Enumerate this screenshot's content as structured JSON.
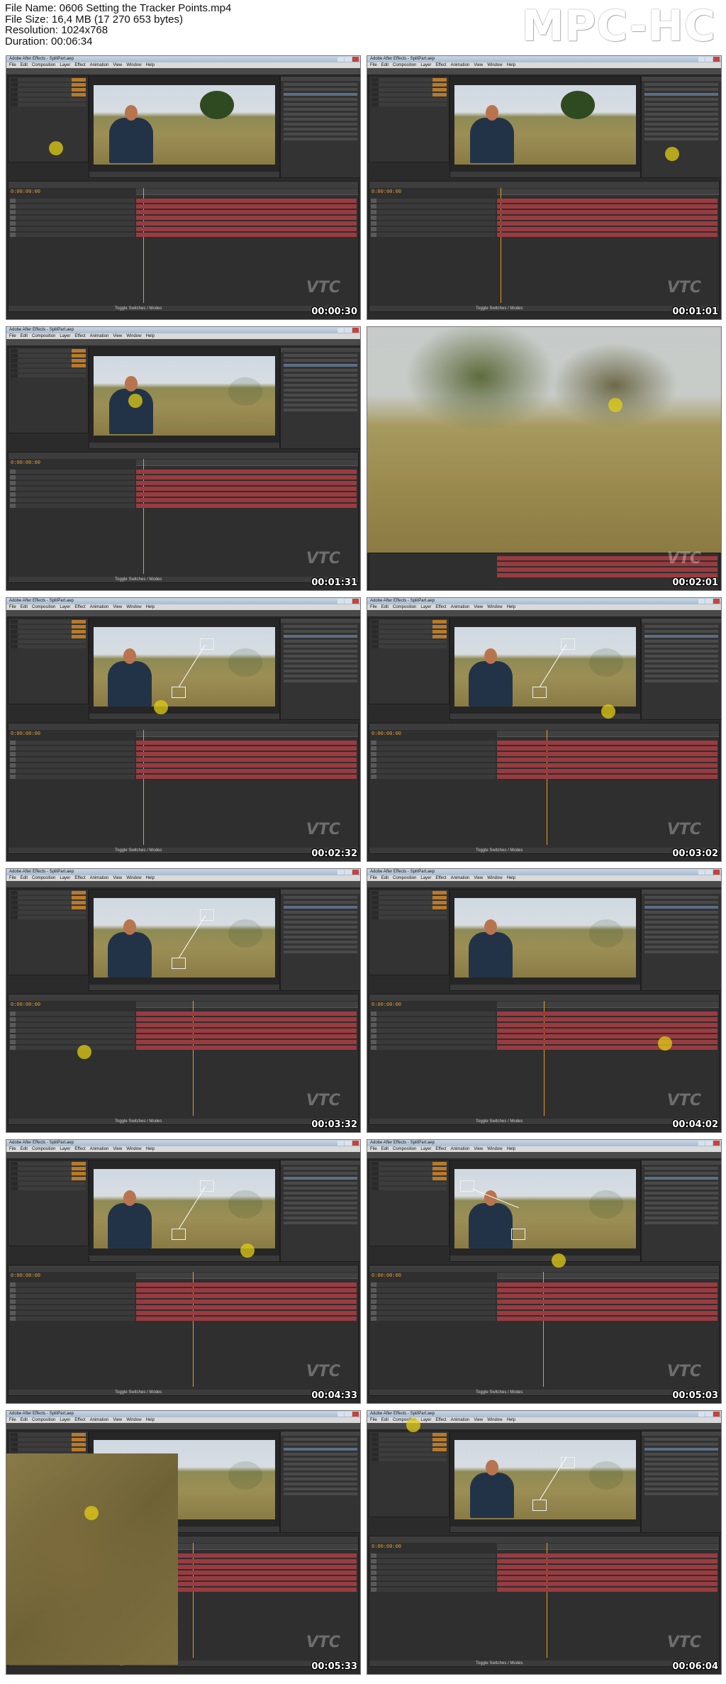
{
  "file_info": {
    "name_line": "File Name: 0606 Setting the Tracker Points.mp4",
    "size_line": "File Size: 16,4 MB (17 270 653 bytes)",
    "resolution_line": "Resolution: 1024x768",
    "duration_line": "Duration: 00:06:34"
  },
  "brand": "MPC-HC",
  "app": {
    "window_title": "Adobe After Effects - SplitPart.aep",
    "menus": [
      "File",
      "Edit",
      "Composition",
      "Layer",
      "Effect",
      "Animation",
      "View",
      "Window",
      "Help"
    ],
    "watermark": "VTC",
    "timeline_footer": "Toggle Switches / Modes",
    "timecode": "0:00:00:00"
  },
  "thumbnails": [
    {
      "timestamp": "00:00:30",
      "kind": "ui"
    },
    {
      "timestamp": "00:01:01",
      "kind": "ui"
    },
    {
      "timestamp": "00:01:31",
      "kind": "ui"
    },
    {
      "timestamp": "00:02:01",
      "kind": "blur"
    },
    {
      "timestamp": "00:02:32",
      "kind": "ui"
    },
    {
      "timestamp": "00:03:02",
      "kind": "ui"
    },
    {
      "timestamp": "00:03:32",
      "kind": "ui"
    },
    {
      "timestamp": "00:04:02",
      "kind": "ui"
    },
    {
      "timestamp": "00:04:33",
      "kind": "ui"
    },
    {
      "timestamp": "00:05:03",
      "kind": "ui"
    },
    {
      "timestamp": "00:05:33",
      "kind": "zoom"
    },
    {
      "timestamp": "00:06:04",
      "kind": "ui"
    }
  ],
  "colors": {
    "cursor_highlight": "#e1cd14",
    "track_layer": "#9a3b40",
    "timecode": "#e6a23a",
    "app_background": "#2b2b2b"
  }
}
